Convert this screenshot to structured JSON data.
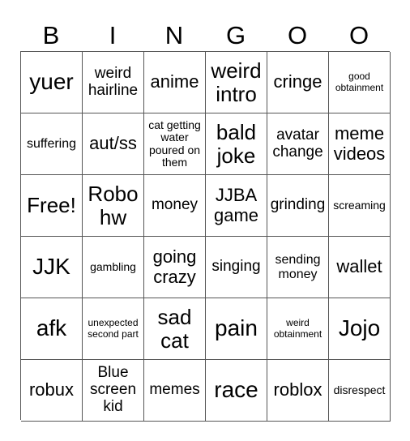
{
  "header": {
    "letters": [
      "B",
      "I",
      "N",
      "G",
      "O",
      "O"
    ]
  },
  "board": {
    "cells": [
      [
        "yuer",
        "weird hairline",
        "anime",
        "weird intro",
        "cringe",
        "good obtainment"
      ],
      [
        "suffering",
        "aut/ss",
        "cat getting water poured on them",
        "bald joke",
        "avatar change",
        "meme videos"
      ],
      [
        "Free!",
        "Robo hw",
        "money",
        "JJBA game",
        "grinding",
        "screaming"
      ],
      [
        "JJK",
        "gambling",
        "going crazy",
        "singing",
        "sending money",
        "wallet"
      ],
      [
        "afk",
        "unexpected second part",
        "sad cat",
        "pain",
        "weird obtainment",
        "Jojo"
      ],
      [
        "robux",
        "Blue screen kid",
        "memes",
        "race",
        "roblox",
        "disrespect"
      ]
    ]
  }
}
